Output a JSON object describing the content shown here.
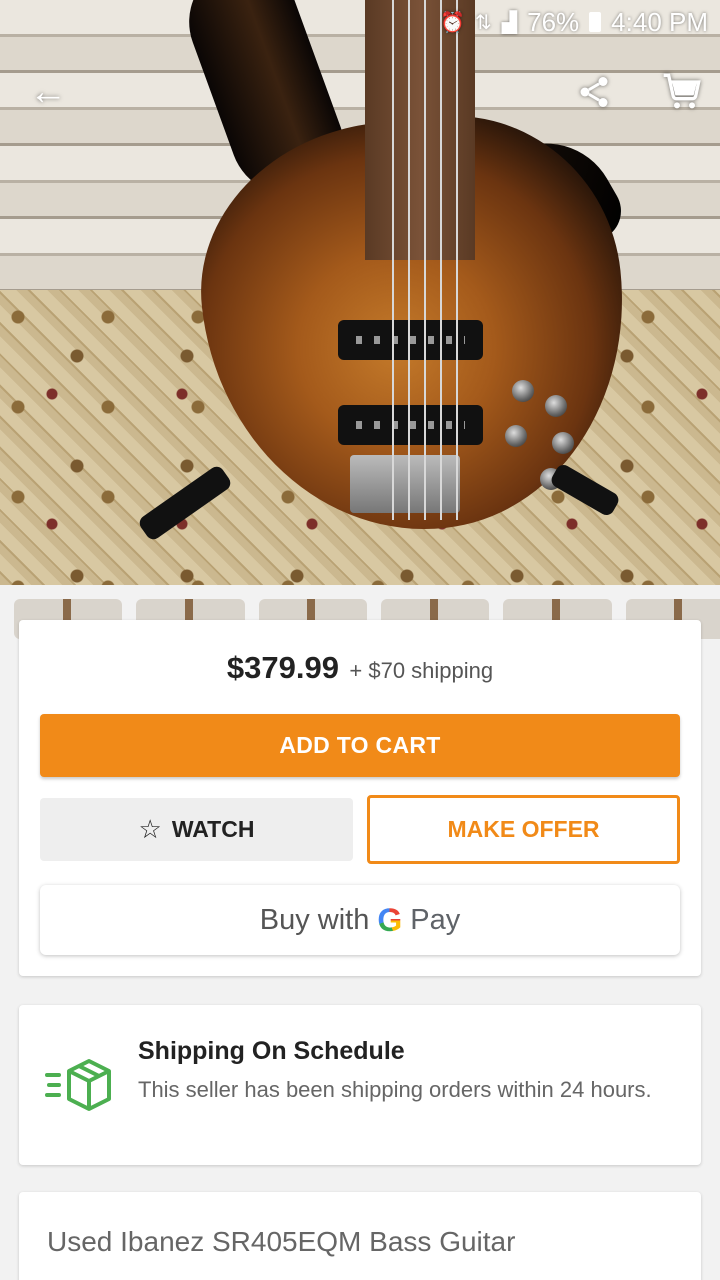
{
  "status_bar": {
    "battery": "76%",
    "time": "4:40 PM",
    "icons": [
      "alarm-icon",
      "network-4g-icon",
      "signal-icon",
      "battery-icon"
    ]
  },
  "top_actions": {
    "back_icon": "arrow-left-icon",
    "share_icon": "share-icon",
    "cart_icon": "cart-icon"
  },
  "hero": {
    "subject": "guitar-product-photo"
  },
  "thumbnails": {
    "count_visible": 6
  },
  "buy_card": {
    "price": "$379.99",
    "shipping": "+ $70 shipping",
    "add_to_cart": "ADD TO CART",
    "watch": "WATCH",
    "watch_icon": "star-outline-icon",
    "make_offer": "MAKE OFFER",
    "gpay_prefix": "Buy with",
    "gpay_g": "G",
    "gpay_suffix": "Pay"
  },
  "shipping_card": {
    "icon": "fast-shipping-box-icon",
    "title": "Shipping On Schedule",
    "description": "This seller has been shipping orders within 24 hours."
  },
  "item": {
    "title": "Used Ibanez SR405EQM Bass Guitar"
  },
  "colors": {
    "accent": "#f18a18",
    "shipping_icon": "#4caf50",
    "background": "#f2f2f2"
  }
}
